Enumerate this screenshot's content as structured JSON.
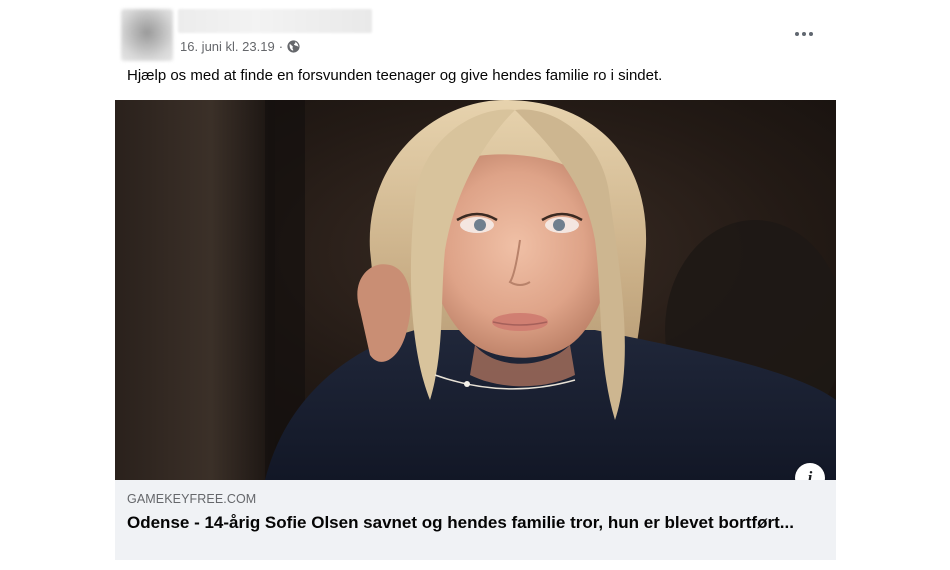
{
  "post": {
    "timestamp": "16. juni kl. 23.19",
    "separator": "·",
    "audience_icon": "globe-icon",
    "more_icon": "more-horizontal-icon",
    "caption": "Hjælp os med at finde en forsvunden teenager og give hendes familie ro i sindet."
  },
  "link_preview": {
    "image_icon": "photo-of-teenage-girl",
    "info_icon": "info-icon",
    "domain": "GAMEKEYFREE.COM",
    "title": "Odense - 14-årig Sofie Olsen savnet og hendes familie tror, hun er blevet bortført..."
  },
  "colors": {
    "secondary_text": "#65676b",
    "link_meta_bg": "#f0f2f5",
    "primary_text": "#050505"
  }
}
